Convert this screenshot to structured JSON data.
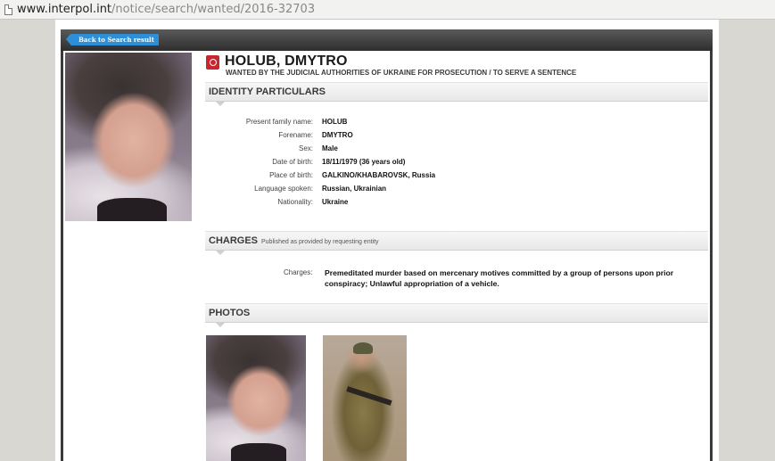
{
  "browser": {
    "url_host": "www.interpol.int",
    "url_path": "/notice/search/wanted/2016-32703"
  },
  "nav": {
    "back_label": "Back to Search result"
  },
  "notice": {
    "name": "HOLUB, DMYTRO",
    "subtitle": "WANTED BY THE JUDICIAL AUTHORITIES OF UKRAINE FOR PROSECUTION / TO SERVE A SENTENCE"
  },
  "identity": {
    "heading": "IDENTITY PARTICULARS",
    "fields": [
      {
        "label": "Present family name:",
        "value": "HOLUB"
      },
      {
        "label": "Forename:",
        "value": "DMYTRO"
      },
      {
        "label": "Sex:",
        "value": "Male"
      },
      {
        "label": "Date of birth:",
        "value": "18/11/1979 (36 years old)"
      },
      {
        "label": "Place of birth:",
        "value": "GALKINO/KHABAROVSK, Russia"
      },
      {
        "label": "Language spoken:",
        "value": "Russian, Ukrainian"
      },
      {
        "label": "Nationality:",
        "value": "Ukraine"
      }
    ]
  },
  "charges": {
    "heading": "CHARGES",
    "note": "Published as provided by requesting entity",
    "label": "Charges:",
    "text": "Premeditated murder based on mercenary motives committed by a group of persons upon prior conspiracy; Unlawful appropriation of a vehicle."
  },
  "photos": {
    "heading": "PHOTOS"
  },
  "icons": {
    "page": "page-icon",
    "logo": "interpol-logo-icon",
    "back": "back-arrow-icon"
  }
}
